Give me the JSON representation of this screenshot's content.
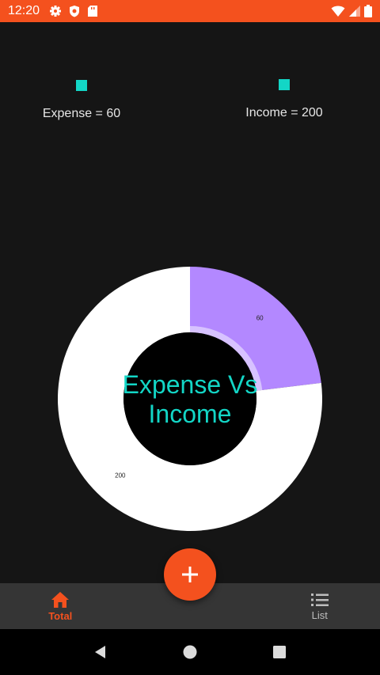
{
  "status_bar": {
    "time": "12:20",
    "background": "#F4511E",
    "icons_left": [
      "gear-icon",
      "shield-icon",
      "sd-card-icon"
    ],
    "icons_right": [
      "wifi-icon",
      "signal-icon",
      "battery-icon"
    ]
  },
  "legend": [
    {
      "label": "Expense = 60",
      "color": "#13D6C6"
    },
    {
      "label": "Income = 200",
      "color": "#13D6C6"
    }
  ],
  "chart_data": {
    "type": "pie",
    "title": "Expense Vs\nIncome",
    "slices": [
      {
        "label": "60",
        "value": 60,
        "color": "#B388FF"
      },
      {
        "label": "200",
        "value": 200,
        "color": "#FFFFFF"
      }
    ],
    "center_color": "#000000",
    "title_color": "#13D6C6"
  },
  "fab": {
    "icon": "plus-icon",
    "color": "#F4511E"
  },
  "bottom_nav": {
    "items": [
      {
        "label": "Total",
        "icon": "home-icon",
        "active": true
      },
      {
        "label": "List",
        "icon": "list-icon",
        "active": false
      }
    ]
  },
  "system_nav": {
    "icons": [
      "back-icon",
      "home-circle-icon",
      "recents-icon"
    ]
  }
}
